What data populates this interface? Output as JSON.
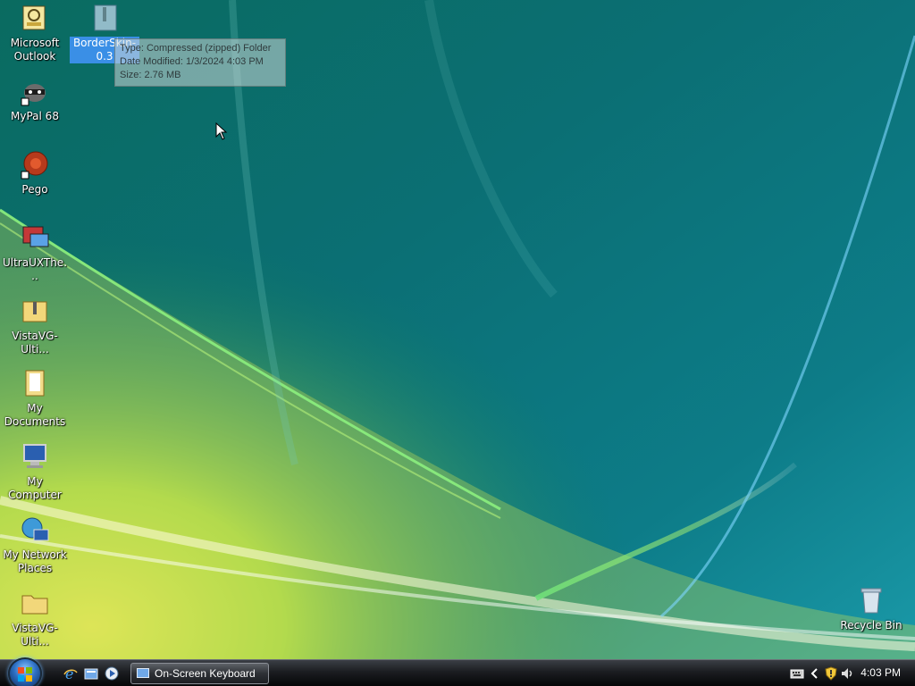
{
  "desktop": {
    "icons": [
      {
        "name": "Microsoft Outlook",
        "label": "Microsoft Outlook"
      },
      {
        "name": "BorderSkin-0.3",
        "label": "BorderSkin-0.3"
      },
      {
        "name": "MyPal 68",
        "label": "MyPal 68"
      },
      {
        "name": "Pego",
        "label": "Pego"
      },
      {
        "name": "UltraUXThe...",
        "label": "UltraUXThe..."
      },
      {
        "name": "VistaVG-Ulti...",
        "label": "VistaVG-Ulti..."
      },
      {
        "name": "My Documents",
        "label": "My Documents"
      },
      {
        "name": "My Computer",
        "label": "My Computer"
      },
      {
        "name": "My Network Places",
        "label": "My Network Places"
      },
      {
        "name": "VistaVG-Ulti... 2",
        "label": "VistaVG-Ulti..."
      },
      {
        "name": "Recycle Bin",
        "label": "Recycle Bin"
      }
    ],
    "selected_icon": "BorderSkin-0.3"
  },
  "tooltip": {
    "type": "Type: Compressed (zipped) Folder",
    "date_modified": "Date Modified: 1/3/2024 4:03 PM",
    "size": "Size: 2.76 MB"
  },
  "taskbar": {
    "quick_launch": [
      "internet-explorer-icon",
      "show-desktop-icon",
      "media-player-icon"
    ],
    "task_button_label": "On-Screen Keyboard",
    "clock": "4:03 PM",
    "tray_icons": [
      "keyboard-icon",
      "chevron-left-icon",
      "security-shield-icon",
      "speaker-icon"
    ]
  },
  "colors": {
    "selection": "#3a8fe6",
    "taskbar": "#1b1d21"
  }
}
